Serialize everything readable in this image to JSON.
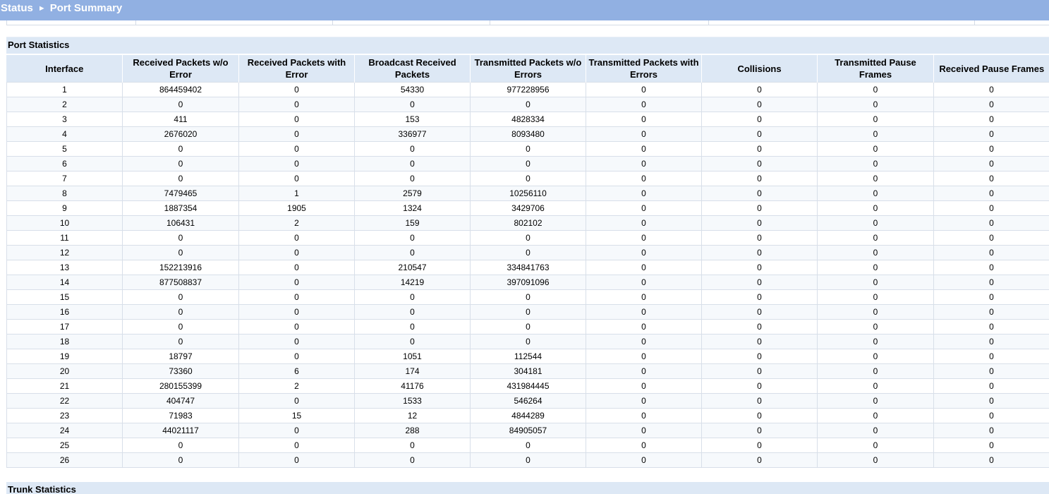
{
  "breadcrumb": {
    "parent": "Status",
    "separator": "►",
    "current": "Port Summary"
  },
  "port_statistics": {
    "title": "Port Statistics",
    "columns": [
      "Interface",
      "Received Packets w/o Error",
      "Received Packets with Error",
      "Broadcast Received Packets",
      "Transmitted Packets w/o Errors",
      "Transmitted Packets with Errors",
      "Collisions",
      "Transmitted Pause Frames",
      "Received Pause Frames"
    ],
    "rows": [
      [
        "1",
        "864459402",
        "0",
        "54330",
        "977228956",
        "0",
        "0",
        "0",
        "0"
      ],
      [
        "2",
        "0",
        "0",
        "0",
        "0",
        "0",
        "0",
        "0",
        "0"
      ],
      [
        "3",
        "411",
        "0",
        "153",
        "4828334",
        "0",
        "0",
        "0",
        "0"
      ],
      [
        "4",
        "2676020",
        "0",
        "336977",
        "8093480",
        "0",
        "0",
        "0",
        "0"
      ],
      [
        "5",
        "0",
        "0",
        "0",
        "0",
        "0",
        "0",
        "0",
        "0"
      ],
      [
        "6",
        "0",
        "0",
        "0",
        "0",
        "0",
        "0",
        "0",
        "0"
      ],
      [
        "7",
        "0",
        "0",
        "0",
        "0",
        "0",
        "0",
        "0",
        "0"
      ],
      [
        "8",
        "7479465",
        "1",
        "2579",
        "10256110",
        "0",
        "0",
        "0",
        "0"
      ],
      [
        "9",
        "1887354",
        "1905",
        "1324",
        "3429706",
        "0",
        "0",
        "0",
        "0"
      ],
      [
        "10",
        "106431",
        "2",
        "159",
        "802102",
        "0",
        "0",
        "0",
        "0"
      ],
      [
        "11",
        "0",
        "0",
        "0",
        "0",
        "0",
        "0",
        "0",
        "0"
      ],
      [
        "12",
        "0",
        "0",
        "0",
        "0",
        "0",
        "0",
        "0",
        "0"
      ],
      [
        "13",
        "152213916",
        "0",
        "210547",
        "334841763",
        "0",
        "0",
        "0",
        "0"
      ],
      [
        "14",
        "877508837",
        "0",
        "14219",
        "397091096",
        "0",
        "0",
        "0",
        "0"
      ],
      [
        "15",
        "0",
        "0",
        "0",
        "0",
        "0",
        "0",
        "0",
        "0"
      ],
      [
        "16",
        "0",
        "0",
        "0",
        "0",
        "0",
        "0",
        "0",
        "0"
      ],
      [
        "17",
        "0",
        "0",
        "0",
        "0",
        "0",
        "0",
        "0",
        "0"
      ],
      [
        "18",
        "0",
        "0",
        "0",
        "0",
        "0",
        "0",
        "0",
        "0"
      ],
      [
        "19",
        "18797",
        "0",
        "1051",
        "112544",
        "0",
        "0",
        "0",
        "0"
      ],
      [
        "20",
        "73360",
        "6",
        "174",
        "304181",
        "0",
        "0",
        "0",
        "0"
      ],
      [
        "21",
        "280155399",
        "2",
        "41176",
        "431984445",
        "0",
        "0",
        "0",
        "0"
      ],
      [
        "22",
        "404747",
        "0",
        "1533",
        "546264",
        "0",
        "0",
        "0",
        "0"
      ],
      [
        "23",
        "71983",
        "15",
        "12",
        "4844289",
        "0",
        "0",
        "0",
        "0"
      ],
      [
        "24",
        "44021117",
        "0",
        "288",
        "84905057",
        "0",
        "0",
        "0",
        "0"
      ],
      [
        "25",
        "0",
        "0",
        "0",
        "0",
        "0",
        "0",
        "0",
        "0"
      ],
      [
        "26",
        "0",
        "0",
        "0",
        "0",
        "0",
        "0",
        "0",
        "0"
      ]
    ]
  },
  "trunk_statistics": {
    "title": "Trunk Statistics"
  },
  "colors": {
    "title_bar": "#91b0e2",
    "section_header": "#dde8f5",
    "row_border": "#d8dfe9"
  }
}
